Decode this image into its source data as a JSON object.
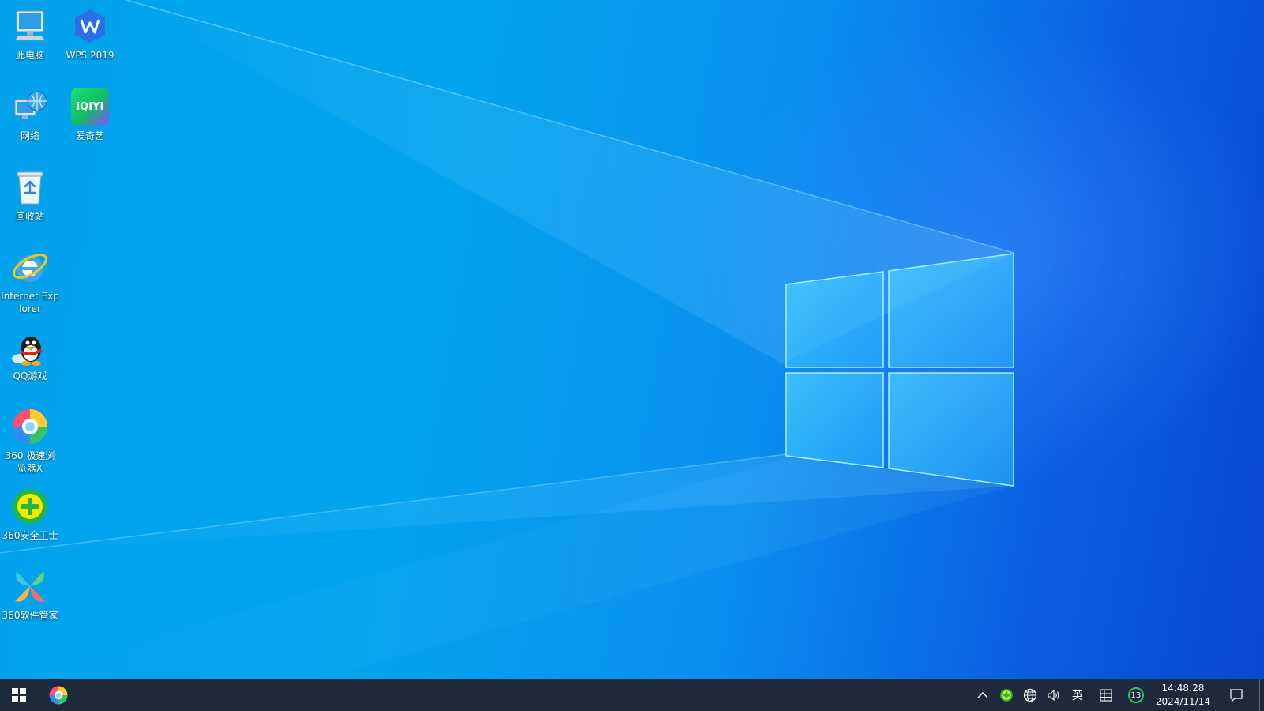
{
  "desktop": {
    "icons": [
      {
        "label": "此电脑",
        "icon": "this-pc-icon"
      },
      {
        "label": "WPS 2019",
        "icon": "wps-icon"
      },
      {
        "label": "网络",
        "icon": "network-icon"
      },
      {
        "label": "爱奇艺",
        "icon": "iqiyi-icon"
      },
      {
        "label": "回收站",
        "icon": "recycle-bin-icon"
      },
      {
        "label": "Internet Explorer",
        "icon": "internet-explorer-icon"
      },
      {
        "label": "QQ游戏",
        "icon": "qq-games-icon"
      },
      {
        "label": "360 极速浏览器X",
        "icon": "360-browser-icon"
      },
      {
        "label": "360安全卫士",
        "icon": "360-security-icon"
      },
      {
        "label": "360软件管家",
        "icon": "360-software-manager-icon"
      }
    ],
    "iqiyi_logo_text": "iQIYI"
  },
  "taskbar": {
    "start_icon": "windows-start-icon",
    "pinned": [
      {
        "icon": "360-browser-icon"
      }
    ],
    "tray": {
      "chevron": "^",
      "ime_label": "英",
      "notification_count": "13",
      "time": "14:48:28",
      "date": "2024/11/14"
    }
  },
  "colors": {
    "taskbar_bg": "#1e2a3c",
    "wallpaper_light": "#03a4ee",
    "wallpaper_dark": "#0a47cf"
  }
}
